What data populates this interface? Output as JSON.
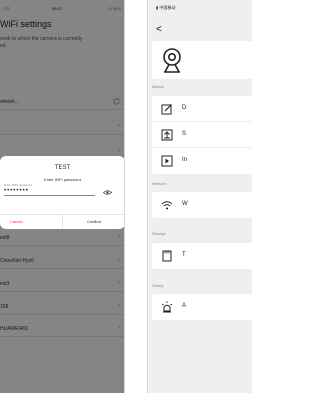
{
  "left_panel": {
    "status_bar": {
      "carrier": "LTE",
      "time": "09:17",
      "battery": "◎ 98%"
    },
    "title": "WiFi settings",
    "description": "work to which the camera is currently\ned.",
    "networks": [
      {
        "label": "etwork..."
      },
      {
        "label": ""
      },
      {
        "label": ""
      },
      {
        "label": ""
      },
      {
        "label": "est8"
      },
      {
        "label": "ChinaNet-Hyx6"
      },
      {
        "label": "est3"
      },
      {
        "label": "168"
      },
      {
        "label": "HUAWEI401"
      }
    ],
    "dialog": {
      "title": "TEST",
      "prompt": "Enter WiFi password",
      "field_label": "Enter WiFi password",
      "password_value": "••••••••",
      "cancel_label": "Cancel",
      "confirm_label": "Confirm"
    }
  },
  "right_panel": {
    "status_bar": {
      "text": "中国移动"
    },
    "back_glyph": "<",
    "sections": [
      {
        "title": "Basics",
        "items": [
          {
            "label": "D",
            "icon": "edit-icon"
          },
          {
            "label": "S",
            "icon": "upload-icon"
          },
          {
            "label": "In",
            "icon": "play-icon"
          }
        ]
      },
      {
        "title": "Network",
        "items": [
          {
            "label": "W",
            "icon": "wifi-icon"
          }
        ]
      },
      {
        "title": "Storage",
        "items": [
          {
            "label": "T",
            "icon": "sd-card-icon"
          }
        ]
      },
      {
        "title": "Safety",
        "items": [
          {
            "label": "A",
            "icon": "alarm-icon"
          }
        ]
      }
    ]
  },
  "colors": {
    "cancel": "#e53935",
    "overlay": "rgba(0,0,0,0.48)",
    "right_bg": "#efefef"
  }
}
